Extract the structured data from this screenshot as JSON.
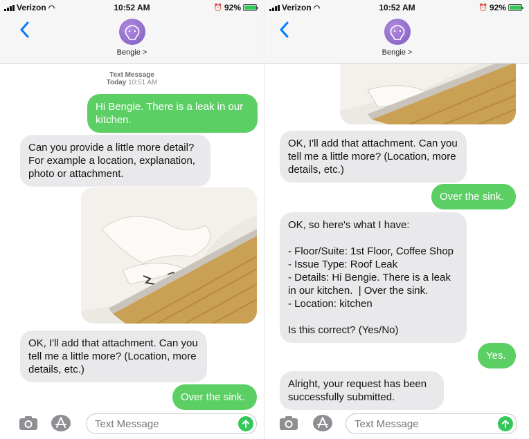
{
  "status": {
    "carrier": "Verizon",
    "time": "10:52 AM",
    "battery": "92%",
    "battery_level": 0.92
  },
  "contact": {
    "name": "Bengie >"
  },
  "left": {
    "timestamp_label": "Text Message",
    "timestamp_day": "Today",
    "timestamp_time": "10:51 AM",
    "messages": [
      {
        "from": "me",
        "text": "Hi Bengie. There is a leak in our kitchen."
      },
      {
        "from": "bot",
        "text": "Can you provide a little more detail? For example a location, explanation, photo or attachment."
      },
      {
        "from": "bot",
        "text": "OK, I'll add that attachment. Can you tell me a little more? (Location, more details, etc.)"
      },
      {
        "from": "me",
        "text": "Over the sink."
      }
    ]
  },
  "right": {
    "messages": [
      {
        "from": "bot",
        "text": "OK, I'll add that attachment. Can you tell me a little more? (Location, more details, etc.)"
      },
      {
        "from": "me",
        "text": "Over the sink."
      },
      {
        "from": "bot",
        "text": "OK, so here's what I have:\n\n- Floor/Suite: 1st Floor, Coffee Shop\n- Issue Type: Roof Leak\n- Details: Hi Bengie. There is a leak in our kitchen.  | Over the sink.\n- Location: kitchen\n\nIs this correct? (Yes/No)"
      },
      {
        "from": "me",
        "text": "Yes."
      },
      {
        "from": "bot",
        "text": "Alright, your request has been successfully submitted."
      }
    ]
  },
  "input": {
    "placeholder": "Text Message"
  },
  "colors": {
    "outgoing_bubble": "#5ccf64",
    "incoming_bubble": "#e9e9eb",
    "accent": "#007aff",
    "send": "#34c759"
  },
  "icons": [
    "back-chevron-icon",
    "contact-avatar-icon",
    "camera-icon",
    "app-store-icon",
    "send-arrow-icon",
    "signal-icon",
    "wifi-icon",
    "battery-icon",
    "alarm-icon"
  ]
}
